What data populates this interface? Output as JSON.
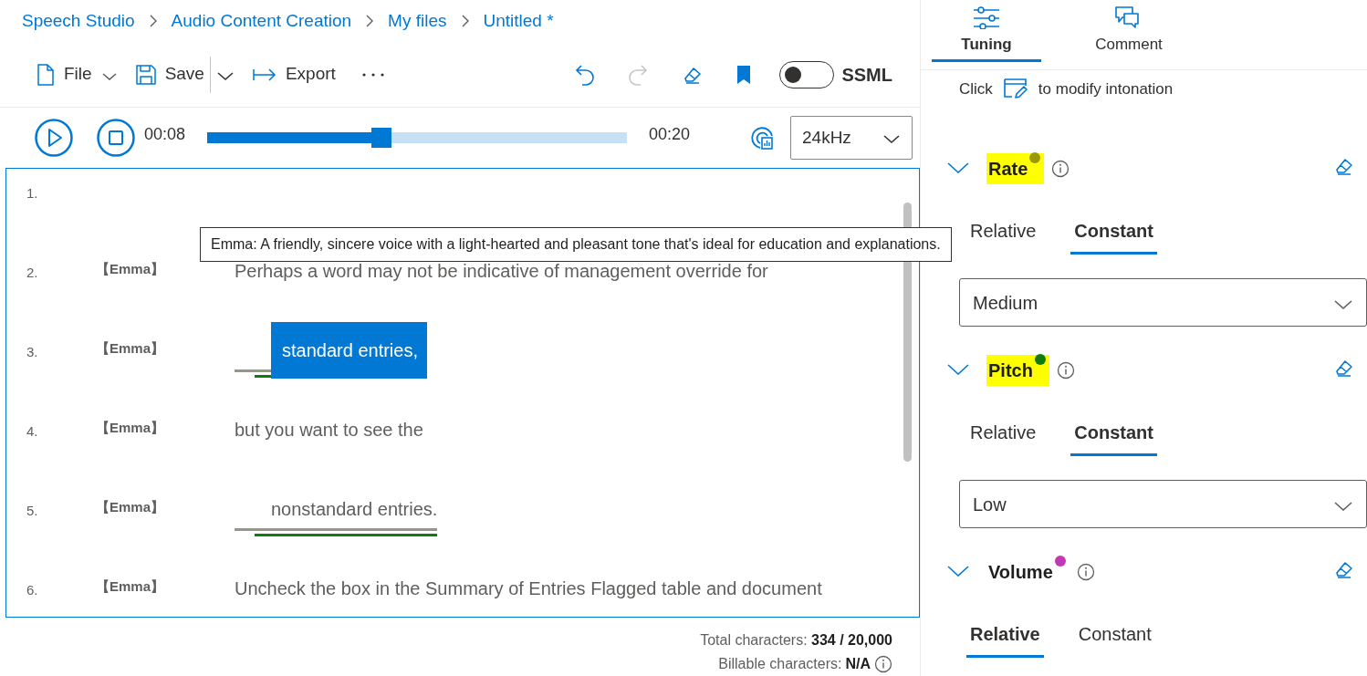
{
  "breadcrumb": [
    {
      "label": "Speech Studio"
    },
    {
      "label": "Audio Content Creation"
    },
    {
      "label": "My files"
    },
    {
      "label": "Untitled *"
    }
  ],
  "toolbar": {
    "file": "File",
    "save": "Save",
    "export": "Export",
    "redo": {
      "disabled": true
    },
    "ssml": {
      "label": "SSML",
      "on": false
    }
  },
  "player": {
    "elapsed": "00:08",
    "duration": "00:20",
    "level": 0.415,
    "sample_rate": "24kHz"
  },
  "editor": {
    "lines": [
      {
        "number": "1."
      },
      {
        "number": "2.",
        "speaker": "【Emma】",
        "text": "Perhaps a word may not be indicative of management override for",
        "tuned": false,
        "selected": false
      },
      {
        "number": "3.",
        "speaker": "【Emma】",
        "text": "standard entries,",
        "tuned": true,
        "selected": true
      },
      {
        "number": "4.",
        "speaker": "【Emma】",
        "text": "but you want to see the",
        "tuned": false,
        "selected": false
      },
      {
        "number": "5.",
        "speaker": "【Emma】",
        "text": "nonstandard entries.",
        "tuned": true,
        "selected": false
      },
      {
        "number": "6.",
        "speaker": "【Emma】",
        "text": "Uncheck the box in the Summary of Entries Flagged table and document",
        "tuned": false,
        "selected": false
      }
    ]
  },
  "tooltip": {
    "text": "Emma: A friendly, sincere voice with a light-hearted and pleasant tone that's ideal for education and explanations."
  },
  "footer": {
    "total_label": "Total characters:",
    "total_value": "334 / 20,000",
    "billable_label": "Billable characters:",
    "billable_value": "N/A"
  },
  "panel": {
    "tabs": [
      {
        "label": "Tuning",
        "kind": "tuning",
        "selected": true
      },
      {
        "label": "Comment",
        "kind": "comment",
        "selected": false
      }
    ],
    "hint": {
      "before": "Click",
      "after": "to modify intonation"
    },
    "sections": [
      {
        "title": "Rate",
        "highlighted": true,
        "color": "#9a9a00",
        "tabs": [
          {
            "label": "Relative",
            "selected": false
          },
          {
            "label": "Constant",
            "selected": true
          }
        ],
        "value": "Medium"
      },
      {
        "title": "Pitch",
        "highlighted": true,
        "color": "#107c10",
        "tabs": [
          {
            "label": "Relative",
            "selected": false
          },
          {
            "label": "Constant",
            "selected": true
          }
        ],
        "value": "Low"
      },
      {
        "title": "Volume",
        "highlighted": false,
        "color": "#c239b3",
        "tabs": [
          {
            "label": "Relative",
            "selected": true
          },
          {
            "label": "Constant",
            "selected": false
          }
        ]
      }
    ]
  }
}
